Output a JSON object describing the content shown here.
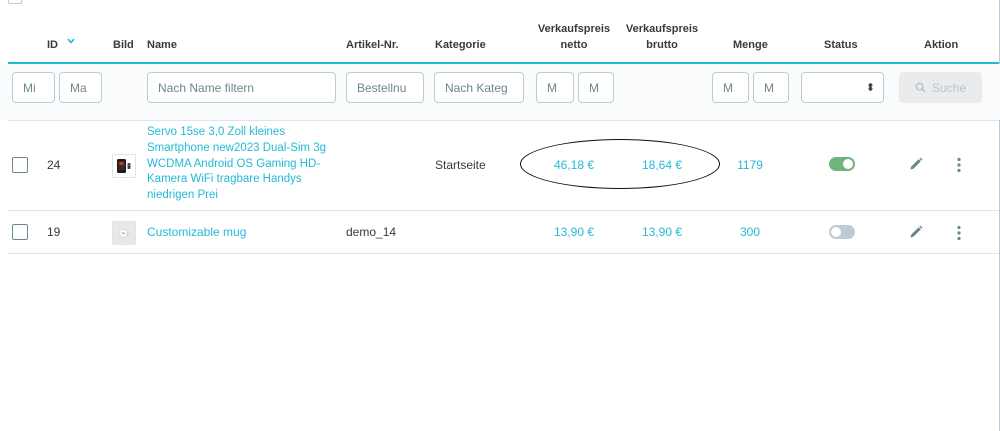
{
  "columns": {
    "id": "ID",
    "image": "Bild",
    "name": "Name",
    "reference": "Artikel-Nr.",
    "category": "Kategorie",
    "price_net_line1": "Verkaufspreis",
    "price_net_line2": "netto",
    "price_gross_line1": "Verkaufspreis",
    "price_gross_line2": "brutto",
    "quantity": "Menge",
    "status": "Status",
    "action": "Aktion"
  },
  "filters": {
    "id_min": "Mi",
    "id_max": "Ma",
    "name": "Nach Name filtern",
    "reference": "Bestellnu",
    "category": "Nach Kateg",
    "price_net_min": "M",
    "price_net_max": "M",
    "quantity_min": "M",
    "quantity_max": "M",
    "status_arrow": "⬍",
    "search_label": "Suche"
  },
  "products": [
    {
      "id": "24",
      "name": "Servo 15se 3,0 Zoll kleines Smartphone new2023 Dual-Sim 3g WCDMA Android OS Gaming HD-Kamera WiFi tragbare Handys niedrigen Prei",
      "reference": "",
      "category": "Startseite",
      "price_net": "46,18 €",
      "price_gross": "18,64 €",
      "quantity": "1179",
      "status": "enabled"
    },
    {
      "id": "19",
      "name": "Customizable mug",
      "reference": "demo_14",
      "category": "",
      "price_net": "13,90 €",
      "price_gross": "13,90 €",
      "quantity": "300",
      "status": "disabled"
    }
  ],
  "colors": {
    "accent": "#25b9d7",
    "toggle_on": "#70b580",
    "toggle_off": "#bbcdd2",
    "text": "#363a41"
  }
}
